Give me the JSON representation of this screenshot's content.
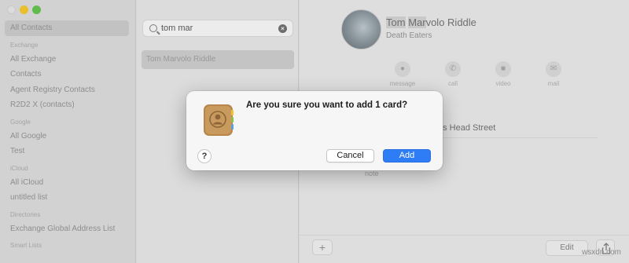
{
  "sidebar": {
    "items": [
      {
        "type": "item",
        "label": "All Contacts",
        "selected": true
      },
      {
        "type": "group",
        "label": "Exchange"
      },
      {
        "type": "item",
        "label": "All Exchange"
      },
      {
        "type": "item",
        "label": "Contacts"
      },
      {
        "type": "item",
        "label": "Agent Registry Contacts"
      },
      {
        "type": "item",
        "label": "R2D2 X (contacts)"
      },
      {
        "type": "group",
        "label": "Google"
      },
      {
        "type": "item",
        "label": "All Google"
      },
      {
        "type": "item",
        "label": "Test"
      },
      {
        "type": "group",
        "label": "iCloud"
      },
      {
        "type": "item",
        "label": "All iCloud"
      },
      {
        "type": "item",
        "label": "untitled list"
      },
      {
        "type": "group",
        "label": "Directories"
      },
      {
        "type": "item",
        "label": "Exchange Global Address List"
      },
      {
        "type": "group",
        "label": "Smart Lists"
      }
    ]
  },
  "search": {
    "value": "tom mar"
  },
  "results": [
    "Tom Marvolo Riddle"
  ],
  "contact": {
    "name_highlight_1": "Tom",
    "name_part_2": " ",
    "name_highlight_2": "Mar",
    "name_rest": "volo Riddle",
    "subtitle": "Death Eaters",
    "actions": [
      "message",
      "call",
      "video",
      "mail"
    ],
    "street": "'s Head Street",
    "note_label": "note"
  },
  "bottom_bar": {
    "add": "+",
    "edit": "Edit"
  },
  "dialog": {
    "message": "Are you sure you want to add 1 card?",
    "help": "?",
    "cancel": "Cancel",
    "confirm": "Add",
    "accent": "#2f7df6"
  },
  "watermark": "wsxdn.com"
}
